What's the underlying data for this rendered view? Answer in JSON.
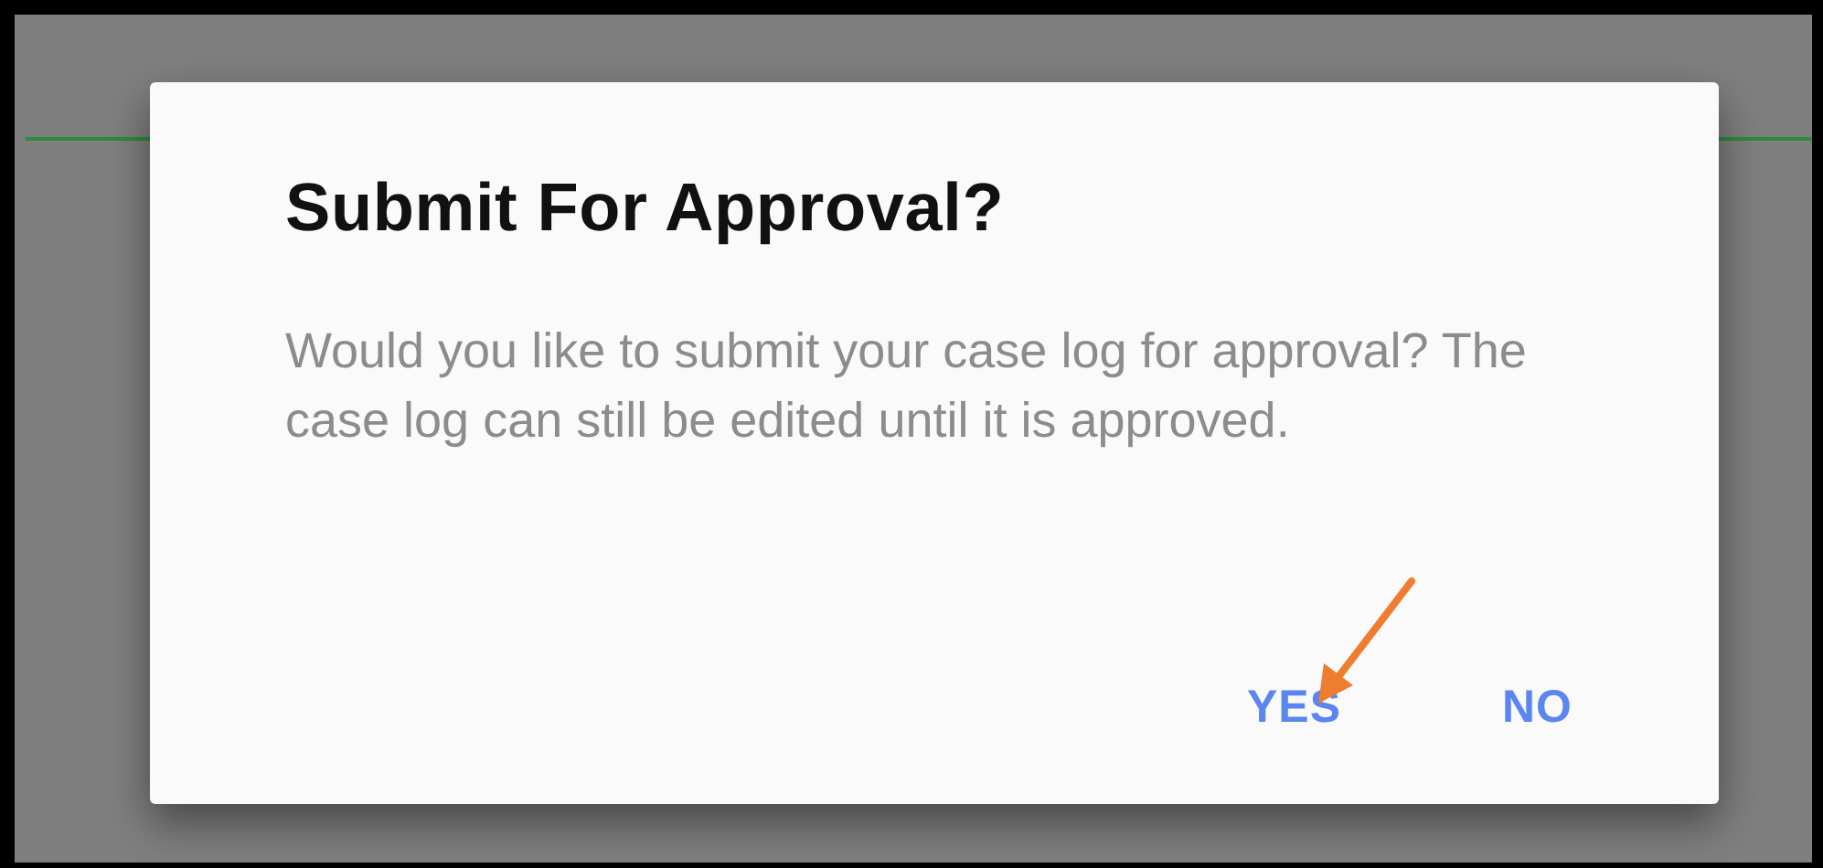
{
  "dialog": {
    "title": "Submit For Approval?",
    "message": "Would you like to submit your case log for approval? The case log can still be edited until it is approved.",
    "buttons": [
      {
        "label": "YES"
      },
      {
        "label": "NO"
      }
    ]
  }
}
